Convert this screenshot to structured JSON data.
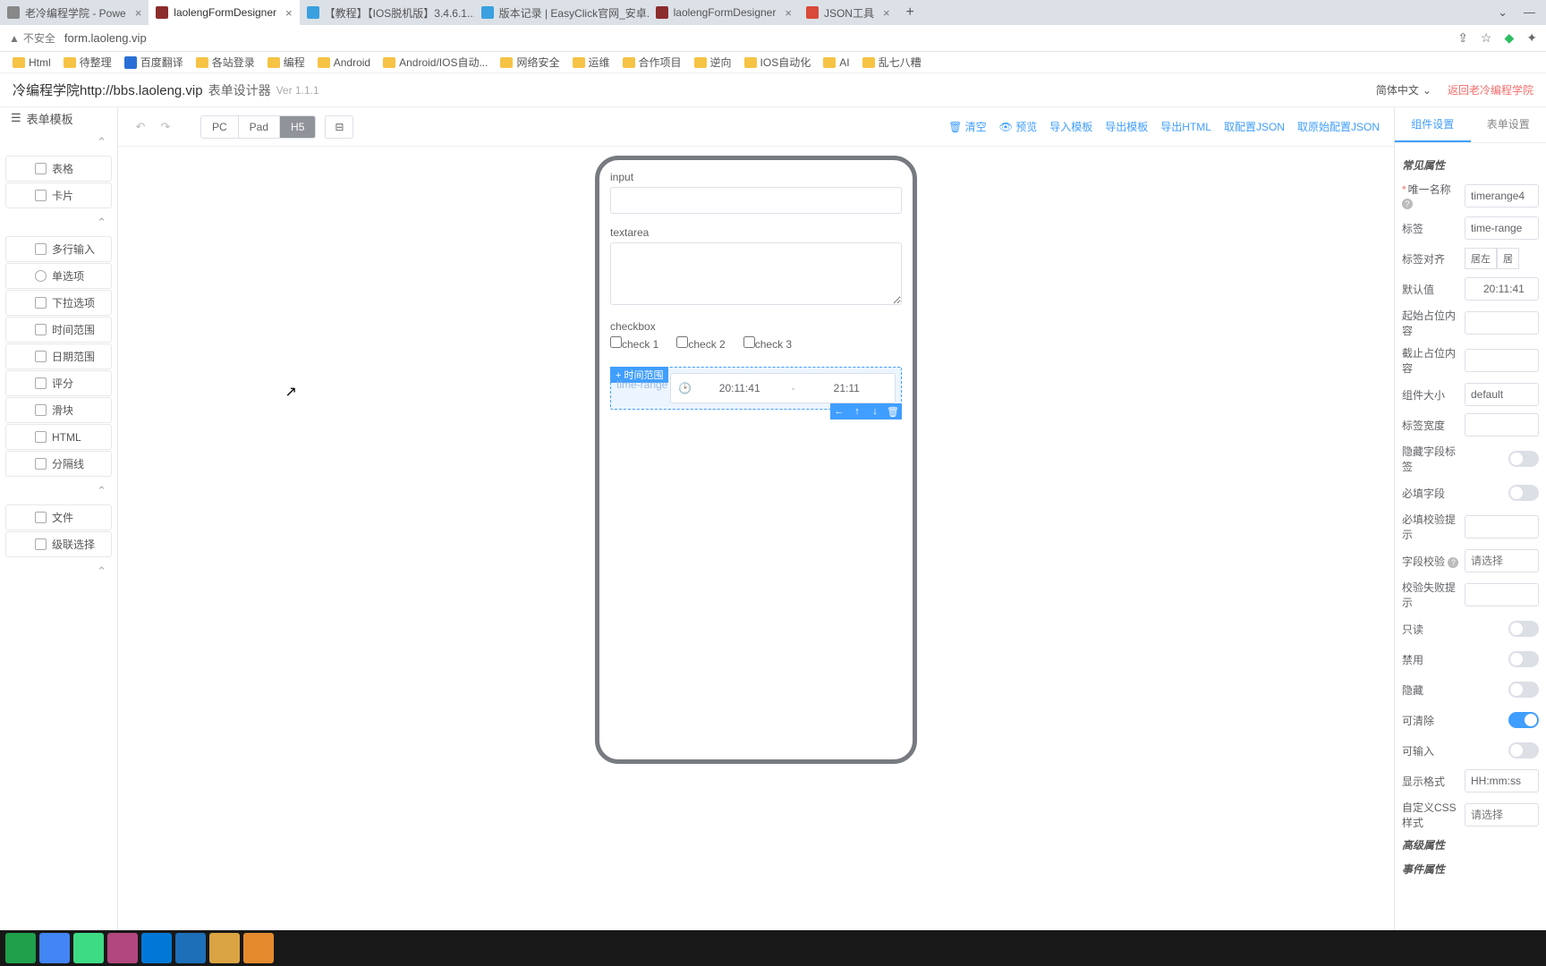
{
  "browser": {
    "tabs": [
      {
        "title": "老冷编程学院 - Powe",
        "active": false
      },
      {
        "title": "laolengFormDesigner",
        "active": true
      },
      {
        "title": "【教程】【IOS脱机版】3.4.6.1...",
        "active": false
      },
      {
        "title": "版本记录 | EasyClick官网_安卓...",
        "active": false
      },
      {
        "title": "laolengFormDesigner",
        "active": false
      },
      {
        "title": "JSON工具",
        "active": false
      }
    ],
    "insecure": "不安全",
    "url": "form.laoleng.vip"
  },
  "bookmarks": [
    "Html",
    "待整理",
    "百度翻译",
    "各站登录",
    "编程",
    "Android",
    "Android/IOS自动...",
    "网络安全",
    "运维",
    "合作项目",
    "逆向",
    "IOS自动化",
    "AI",
    "乱七八糟"
  ],
  "header": {
    "title": "冷编程学院http://bbs.laoleng.vip",
    "sub": "表单设计器",
    "ver": "Ver 1.1.1",
    "lang": "简体中文",
    "back": "返回老冷编程学院"
  },
  "sidebar": {
    "head": "表单模板",
    "items1": [
      "表格",
      "卡片"
    ],
    "items2": [
      "多行输入",
      "单选项",
      "下拉选项",
      "时间范围",
      "日期范围",
      "评分",
      "滑块",
      "HTML",
      "分隔线"
    ],
    "items3": [
      "文件",
      "级联选择"
    ]
  },
  "toolbar": {
    "seg": [
      "PC",
      "Pad",
      "H5"
    ],
    "actions": {
      "clear": "清空",
      "preview": "预览",
      "importTpl": "导入模板",
      "exportTpl": "导出模板",
      "exportHtml": "导出HTML",
      "getJson": "取配置JSON",
      "getRawJson": "取原始配置JSON"
    }
  },
  "canvas": {
    "input": {
      "label": "input"
    },
    "textarea": {
      "label": "textarea"
    },
    "checkbox": {
      "label": "checkbox",
      "options": [
        "check 1",
        "check 2",
        "check 3"
      ]
    },
    "timerange": {
      "badge": "时间范围",
      "label": "time-range",
      "start": "20:11:41",
      "end": "21:11"
    }
  },
  "propsTabs": [
    "组件设置",
    "表单设置"
  ],
  "props": {
    "sec1": "常见属性",
    "uniqueName": {
      "label": "唯一名称",
      "value": "timerange4"
    },
    "label": {
      "label": "标签",
      "value": "time-range"
    },
    "labelAlign": {
      "label": "标签对齐",
      "opts": [
        "居左",
        "居"
      ]
    },
    "defaultVal": {
      "label": "默认值",
      "value": "20:11:41"
    },
    "startPh": {
      "label": "起始占位内容",
      "value": ""
    },
    "endPh": {
      "label": "截止占位内容",
      "value": ""
    },
    "size": {
      "label": "组件大小",
      "value": "default"
    },
    "labelWidth": {
      "label": "标签宽度",
      "value": ""
    },
    "hideLabel": {
      "label": "隐藏字段标签",
      "on": false
    },
    "required": {
      "label": "必填字段",
      "on": false
    },
    "requiredMsg": {
      "label": "必填校验提示",
      "value": ""
    },
    "validator": {
      "label": "字段校验",
      "ph": "请选择"
    },
    "failMsg": {
      "label": "校验失败提示",
      "value": ""
    },
    "readonly": {
      "label": "只读",
      "on": false
    },
    "disabled": {
      "label": "禁用",
      "on": false
    },
    "hidden": {
      "label": "隐藏",
      "on": false
    },
    "clearable": {
      "label": "可清除",
      "on": true
    },
    "editable": {
      "label": "可输入",
      "on": false
    },
    "format": {
      "label": "显示格式",
      "value": "HH:mm:ss"
    },
    "css": {
      "label": "自定义CSS样式",
      "ph": "请选择"
    },
    "sec2": "高级属性",
    "sec3": "事件属性"
  }
}
